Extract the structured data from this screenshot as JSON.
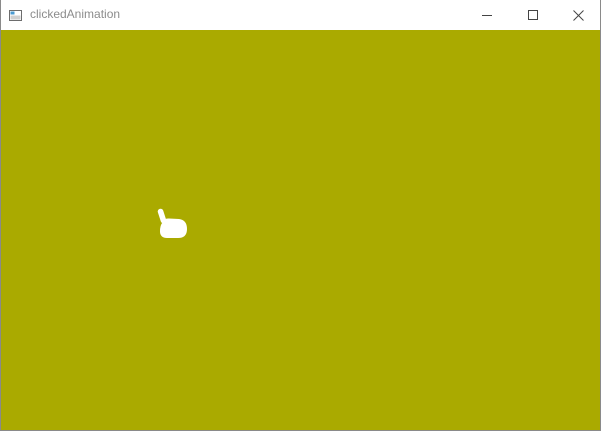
{
  "window": {
    "title": "clickedAnimation",
    "controls": {
      "minimize_icon": "minimize-icon",
      "maximize_icon": "maximize-icon",
      "close_icon": "close-icon"
    }
  },
  "client": {
    "background_color": "#aaaa00",
    "cursor": {
      "icon": "hand-pointer-icon",
      "color": "#ffffff"
    }
  },
  "colors": {
    "titlebar_bg": "#ffffff",
    "title_text": "#8c8c8c",
    "icon_stroke": "#444444"
  }
}
